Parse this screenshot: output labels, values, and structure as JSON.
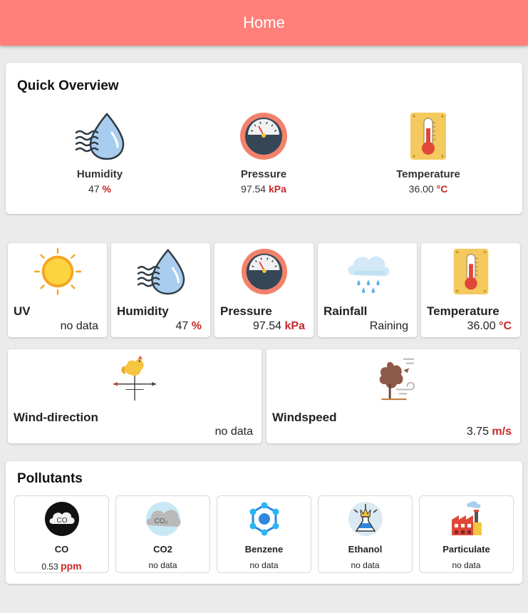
{
  "appbar": {
    "title": "Home"
  },
  "quick_overview": {
    "title": "Quick Overview",
    "humidity": {
      "label": "Humidity",
      "value": "47",
      "unit": "%"
    },
    "pressure": {
      "label": "Pressure",
      "value": "97.54",
      "unit": "kPa"
    },
    "temperature": {
      "label": "Temperature",
      "value": "36.00",
      "unit": "°C"
    }
  },
  "tiles": {
    "uv": {
      "label": "UV",
      "value": "no data"
    },
    "humidity": {
      "label": "Humidity",
      "value": "47",
      "unit": "%"
    },
    "pressure": {
      "label": "Pressure",
      "value": "97.54",
      "unit": "kPa"
    },
    "rainfall": {
      "label": "Rainfall",
      "value": "Raining"
    },
    "temperature": {
      "label": "Temperature",
      "value": "36.00",
      "unit": "°C"
    },
    "wind_direction": {
      "label": "Wind-direction",
      "value": "no data"
    },
    "windspeed": {
      "label": "Windspeed",
      "value": "3.75",
      "unit": "m/s"
    }
  },
  "pollutants": {
    "title": "Pollutants",
    "co": {
      "label": "CO",
      "value": "0.53",
      "unit": "ppm",
      "icon_text": "CO"
    },
    "co2": {
      "label": "CO2",
      "value": "no data",
      "icon_text": "CO₂"
    },
    "benzene": {
      "label": "Benzene",
      "value": "no data"
    },
    "ethanol": {
      "label": "Ethanol",
      "value": "no data"
    },
    "particulate": {
      "label": "Particulate",
      "value": "no data"
    }
  },
  "colors": {
    "appbar": "#ff7f7a",
    "unit": "#c62828",
    "background": "#ebebeb"
  },
  "icons": [
    "humidity-icon",
    "pressure-gauge-icon",
    "thermometer-icon",
    "sun-icon",
    "rain-cloud-icon",
    "weathervane-icon",
    "wind-tree-icon",
    "co-cloud-icon",
    "co2-cloud-icon",
    "benzene-molecule-icon",
    "ethanol-flask-icon",
    "factory-icon"
  ]
}
